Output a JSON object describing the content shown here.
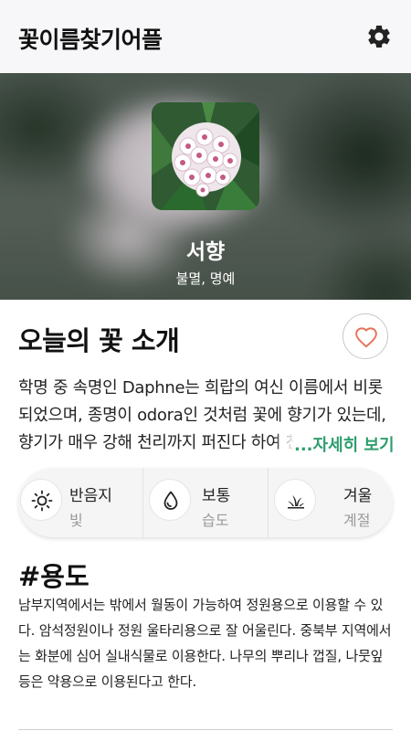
{
  "app": {
    "title": "꽃이름찾기어플",
    "settings_icon": "gear-icon"
  },
  "hero": {
    "flower_name": "서향",
    "flower_meaning": "불멸, 명예"
  },
  "intro": {
    "title": "오늘의 꽃 소개",
    "favorite_icon": "heart-outline-icon",
    "description": "학명 중 속명인 Daphne는 희랍의 여신 이름에서 비롯되었으며, 종명이 odora인 것처럼 꽃에 향기가 있는데, 향기가 매우 강해 천리까지 퍼진다 하여 천리향이라고도 한다.",
    "more_label": "...자세히 보기",
    "accent_color": "#2f9e6e"
  },
  "info": [
    {
      "icon": "sun-icon",
      "value": "반음지",
      "label": "빛"
    },
    {
      "icon": "water-drop-icon",
      "value": "보통",
      "label": "습도"
    },
    {
      "icon": "sprout-icon",
      "value": "겨울",
      "label": "계절"
    }
  ],
  "usage": {
    "title": "#용도",
    "text": "남부지역에서는 밖에서 월동이 가능하여 정원용으로 이용할 수 있다. 암석정원이나 정원 울타리용으로 잘 어울린다. 중북부 지역에서는 화분에 심어 실내식물로 이용한다. 나무의 뿌리나 껍질, 나뭇잎 등은 약용으로 이용된다고 한다."
  }
}
